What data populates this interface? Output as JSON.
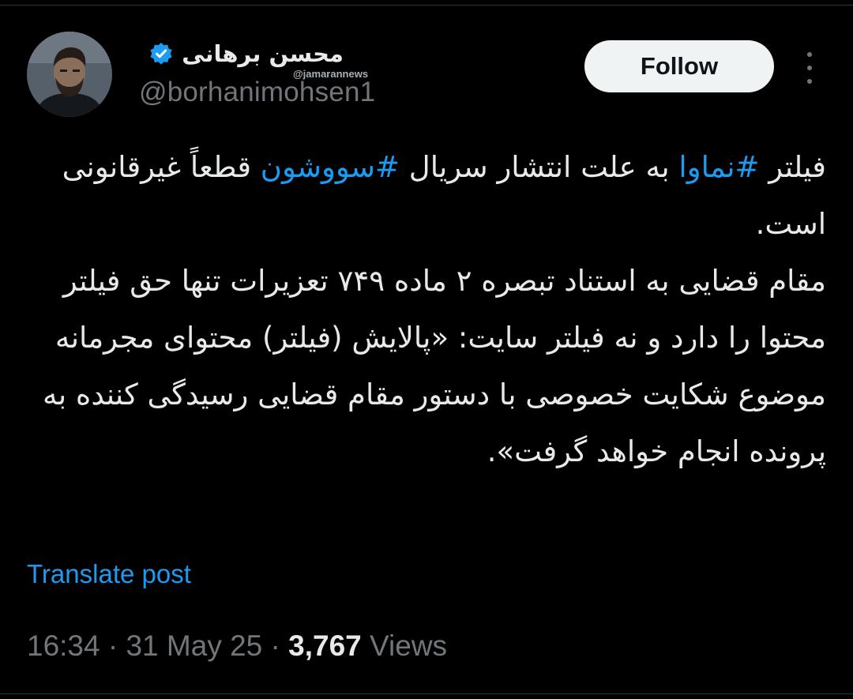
{
  "author": {
    "display_name": "محسن برهانی",
    "handle": "@borhanimohsen1",
    "verified_icon": "verified-badge-icon",
    "avatar_icon": "profile-photo"
  },
  "watermark": "@jamarannews",
  "header": {
    "follow_label": "Follow",
    "more_icon": "more-options-icon"
  },
  "tweet": {
    "seg1": "فیلتر ",
    "hashtag1": "#نماوا",
    "seg2": " به علت انتشار سریال ",
    "hashtag2": "#سووشون",
    "seg3": " قطعاً غیرقانونی است.",
    "para2": "مقام قضایی به استناد تبصره ۲ ماده ۷۴۹ تعزیرات تنها حق فیلتر محتوا را دارد و نه فیلتر سایت: «پالایش (فیلتر) محتوای مجرمانه موضوع شکایت خصوصی با دستور مقام قضایی رسیدگی کننده به پرونده انجام خواهد گرفت».",
    "translate_label": "Translate post"
  },
  "meta": {
    "time": "16:34",
    "sep1": " · ",
    "date": "31 May 25",
    "sep2": " · ",
    "views_count": "3,767",
    "views_label": " Views"
  },
  "colors": {
    "background": "#000000",
    "text": "#e7e9ea",
    "secondary": "#71767b",
    "link": "#1d9bf0",
    "verified": "#1d9bf0",
    "button_bg": "#eff3f4"
  }
}
